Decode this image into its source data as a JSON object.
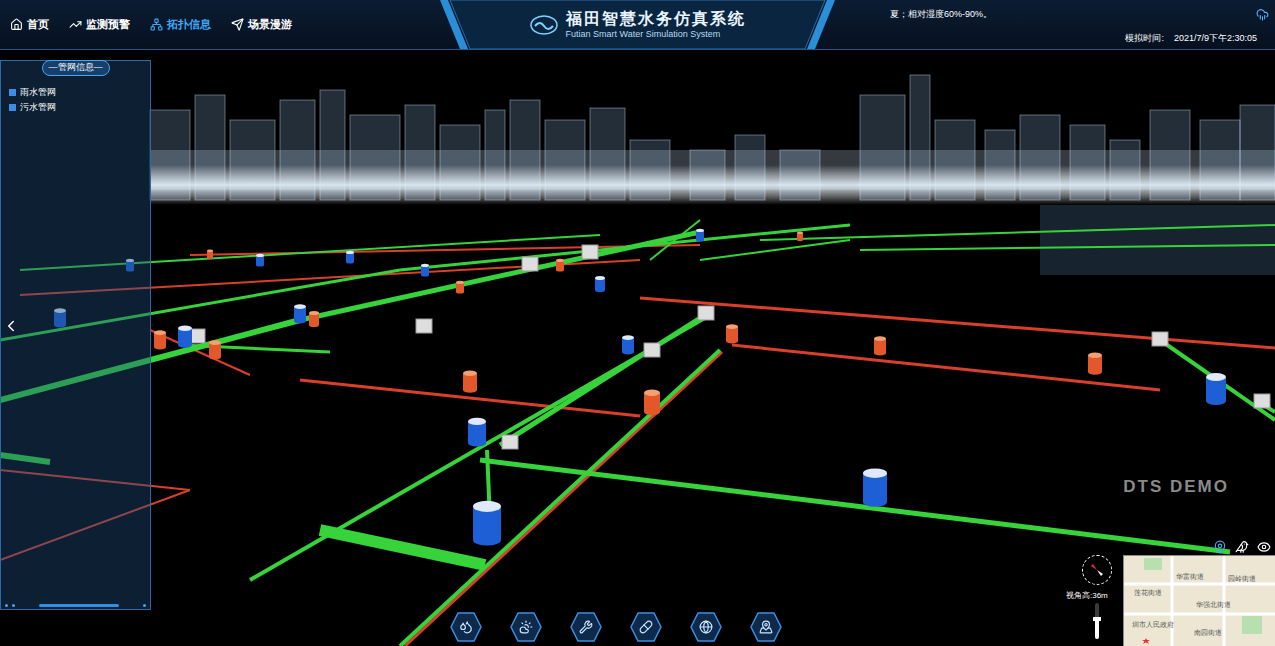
{
  "nav": [
    {
      "label": "首页",
      "selected": false
    },
    {
      "label": "监测预警",
      "selected": false
    },
    {
      "label": "拓扑信息",
      "selected": true
    },
    {
      "label": "场景漫游",
      "selected": false
    }
  ],
  "title": "福田智慧水务仿真系统",
  "subtitle": "Futian Smart Water Simulation System",
  "weather": "夏；相对湿度60%-90%。",
  "sim_time": {
    "label": "模拟时间:",
    "value": "2021/7/9下午2:30:05"
  },
  "panel": {
    "title": "—管网信息—",
    "networks": [
      {
        "label": "雨水管网",
        "checked": true,
        "color": "#36d43a"
      },
      {
        "label": "污水管网",
        "checked": true,
        "color": "#d9402c"
      }
    ]
  },
  "watermark": "DTS DEMO",
  "view_height": "视角高:36m",
  "zoom_slider": {
    "level": 0.55
  },
  "minimap": {
    "labels": [
      "华富街道",
      "园岭街道",
      "莲花街道",
      "华强北街道",
      "圳市人民政府",
      "南园街道"
    ]
  }
}
